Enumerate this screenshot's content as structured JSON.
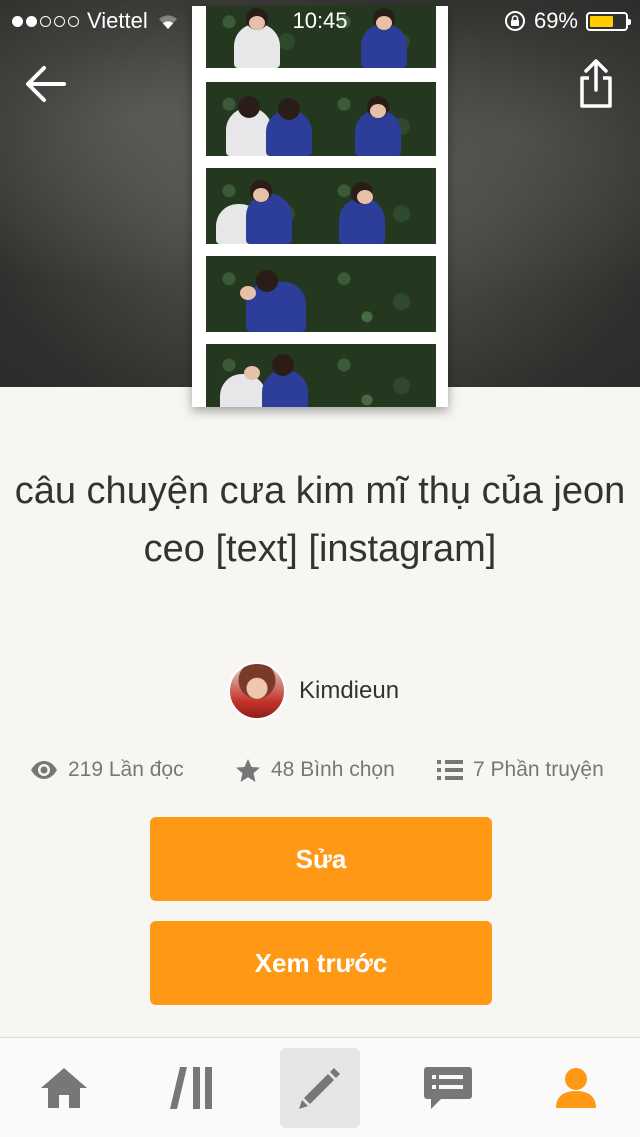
{
  "status_bar": {
    "carrier": "Viettel",
    "time": "10:45",
    "battery_percent": "69%",
    "battery_level": 0.69,
    "signal_bars": 2,
    "battery_color": "#ffcc00"
  },
  "header": {
    "back_icon": "back-arrow-icon",
    "share_icon": "share-icon"
  },
  "story": {
    "title": "câu chuyện cưa kim mĩ thụ của jeon ceo [text] [instagram]",
    "author": "Kimdieun",
    "stats": {
      "reads": "219 Lần đọc",
      "votes": "48 Bình chọn",
      "parts": "7 Phần truyện"
    }
  },
  "actions": {
    "edit_label": "Sửa",
    "preview_label": "Xem trước"
  },
  "tab_bar": {
    "items": [
      "home-icon",
      "library-icon",
      "write-icon",
      "messages-icon",
      "profile-icon"
    ],
    "active": "write-icon"
  },
  "colors": {
    "accent": "#ff9814",
    "background": "#f7f6f2",
    "text": "#333333",
    "muted": "#777777"
  }
}
